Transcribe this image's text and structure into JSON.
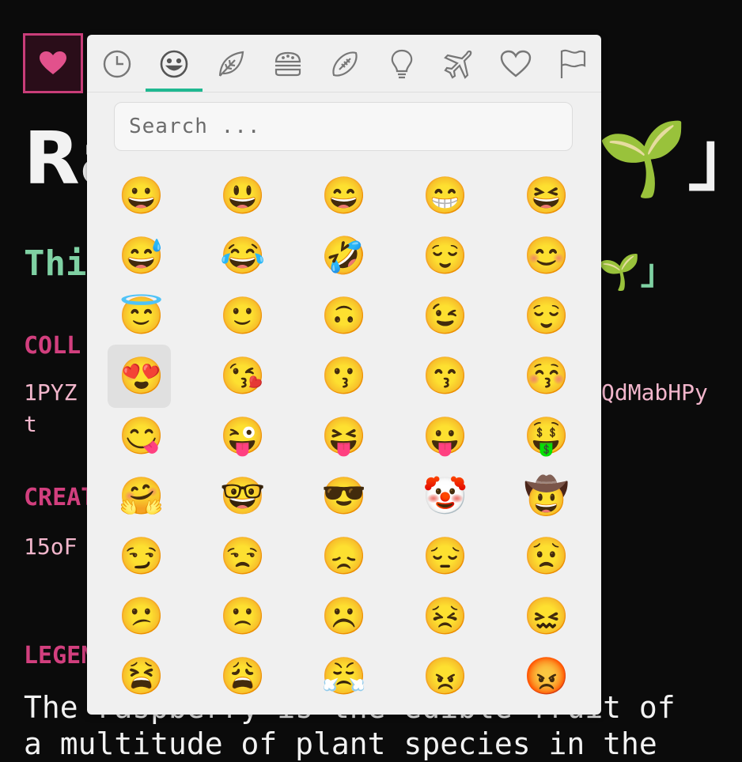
{
  "page": {
    "title_head": "Ra",
    "title_tail": "🌱」",
    "subtitle_head": "Thi",
    "subtitle_tail": "🌱」",
    "collection_label": "COLL",
    "collection_value_head": "1PYZ",
    "collection_value_tail": "QdMabHPy",
    "collection_value_wrap": "t",
    "creator_label": "CREAT",
    "creator_value": "15oF",
    "legend_label": "LEGEN",
    "legend_text_line1": "The raspberry is the edible fruit of",
    "legend_text_line2": "a multitude of plant species in the"
  },
  "favorite_button": {
    "icon": "heart-icon",
    "color": "#e2518c"
  },
  "picker": {
    "tabs": [
      {
        "name": "recent",
        "icon": "clock-icon"
      },
      {
        "name": "smileys",
        "icon": "smiley-icon"
      },
      {
        "name": "nature",
        "icon": "leaf-icon"
      },
      {
        "name": "food",
        "icon": "burger-icon"
      },
      {
        "name": "activity",
        "icon": "football-icon"
      },
      {
        "name": "objects",
        "icon": "lightbulb-icon"
      },
      {
        "name": "travel",
        "icon": "airplane-icon"
      },
      {
        "name": "symbols",
        "icon": "heart-outline-icon"
      },
      {
        "name": "flags",
        "icon": "flag-icon"
      }
    ],
    "active_tab": "smileys",
    "accent": "#1fb891",
    "search_placeholder": "Search ...",
    "selected_emoji": "😍",
    "emojis": [
      [
        "😀",
        "😃",
        "😄",
        "😁",
        "😆"
      ],
      [
        "😅",
        "😂",
        "🤣",
        "😌",
        "😊"
      ],
      [
        "😇",
        "🙂",
        "🙃",
        "😉",
        "😌"
      ],
      [
        "😍",
        "😘",
        "😗",
        "😙",
        "😚"
      ],
      [
        "😋",
        "😜",
        "😝",
        "😛",
        "🤑"
      ],
      [
        "🤗",
        "🤓",
        "😎",
        "🤡",
        "🤠"
      ],
      [
        "😏",
        "😒",
        "😞",
        "😔",
        "😟"
      ],
      [
        "😕",
        "🙁",
        "☹️",
        "😣",
        "😖"
      ],
      [
        "😫",
        "😩",
        "😤",
        "😠",
        "😡"
      ]
    ]
  }
}
